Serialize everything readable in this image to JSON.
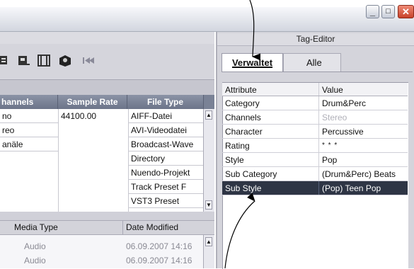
{
  "right_panel": {
    "title": "Tag-Editor",
    "tabs": [
      {
        "label": "Verwaltet",
        "active": true
      },
      {
        "label": "Alle",
        "active": false
      }
    ],
    "columns": {
      "attribute": "Attribute",
      "value": "Value"
    },
    "rows": [
      {
        "attribute": "Category",
        "value": "Drum&Perc",
        "dimmed": false
      },
      {
        "attribute": "Channels",
        "value": "Stereo",
        "dimmed": true
      },
      {
        "attribute": "Character",
        "value": "Percussive",
        "dimmed": false
      },
      {
        "attribute": "Rating",
        "value": "* * *",
        "dimmed": false
      },
      {
        "attribute": "Style",
        "value": "Pop",
        "dimmed": false
      },
      {
        "attribute": "Sub Category",
        "value": "(Drum&Perc) Beats",
        "dimmed": false
      },
      {
        "attribute": "Sub Style",
        "value": "(Pop) Teen Pop",
        "selected": true
      }
    ]
  },
  "left_panel": {
    "columns": [
      "hannels",
      "Sample Rate",
      "File Type"
    ],
    "channels": [
      "no",
      "reo",
      "anäle"
    ],
    "sample_rate": [
      "44100.00"
    ],
    "file_types": [
      "AIFF-Datei",
      "AVI-Videodatei",
      "Broadcast-Wave",
      "Directory",
      "Nuendo-Projekt",
      "Track Preset F",
      "VST3 Preset"
    ],
    "lower_columns": [
      "Media Type",
      "Date Modified"
    ],
    "lower_rows": [
      {
        "media_type": "Audio",
        "date": "06.09.2007 14:16"
      },
      {
        "media_type": "Audio",
        "date": "06.09.2007 14:16"
      }
    ]
  },
  "colors": {
    "header": "#7a8296",
    "selection": "#2e3545",
    "close": "#c7422a"
  }
}
